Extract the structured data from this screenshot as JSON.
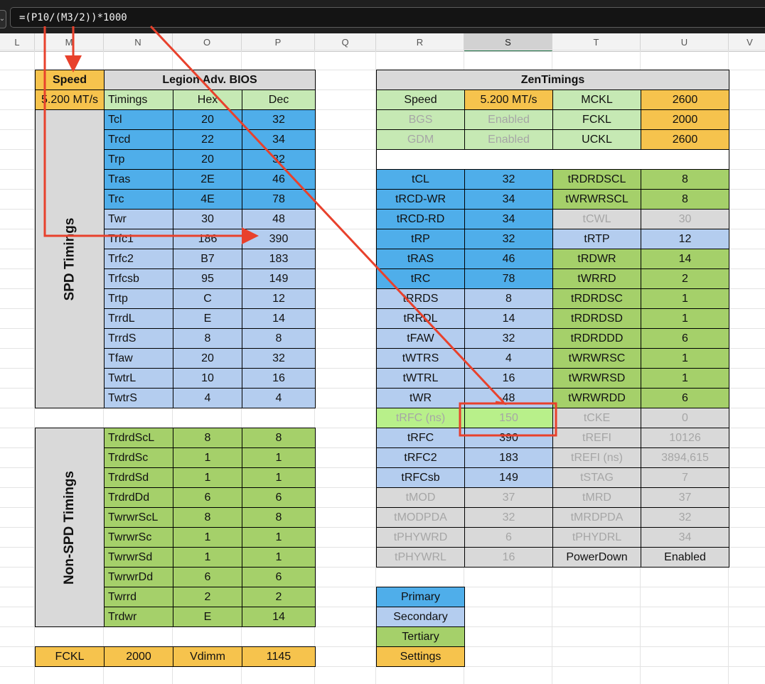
{
  "formula_bar": {
    "formula": "=(P10/(M3/2))*1000"
  },
  "column_headers": [
    "L",
    "M",
    "N",
    "O",
    "P",
    "Q",
    "R",
    "S",
    "T",
    "U",
    "V"
  ],
  "colors": {
    "primary": "#4faeea",
    "secondary": "#b4cdef",
    "tertiary": "#a5d06a",
    "settings": "#f6c34d",
    "header_green": "#c6e9b4",
    "arrow_red": "#e8412c"
  },
  "legion": {
    "speed_label": "Speed",
    "speed_value": "5.200 MT/s",
    "title": "Legion Adv. BIOS",
    "col_timings": "Timings",
    "col_hex": "Hex",
    "col_dec": "Dec",
    "spd_label": "SPD Timings",
    "nonspd_label": "Non-SPD Timings",
    "spd_rows": [
      {
        "name": "Tcl",
        "hex": "20",
        "dec": "32",
        "cat": "primary"
      },
      {
        "name": "Trcd",
        "hex": "22",
        "dec": "34",
        "cat": "primary"
      },
      {
        "name": "Trp",
        "hex": "20",
        "dec": "32",
        "cat": "primary"
      },
      {
        "name": "Tras",
        "hex": "2E",
        "dec": "46",
        "cat": "primary"
      },
      {
        "name": "Trc",
        "hex": "4E",
        "dec": "78",
        "cat": "primary"
      },
      {
        "name": "Twr",
        "hex": "30",
        "dec": "48",
        "cat": "secondary"
      },
      {
        "name": "Trfc1",
        "hex": "186",
        "dec": "390",
        "cat": "secondary"
      },
      {
        "name": "Trfc2",
        "hex": "B7",
        "dec": "183",
        "cat": "secondary"
      },
      {
        "name": "Trfcsb",
        "hex": "95",
        "dec": "149",
        "cat": "secondary"
      },
      {
        "name": "Trtp",
        "hex": "C",
        "dec": "12",
        "cat": "secondary"
      },
      {
        "name": "TrrdL",
        "hex": "E",
        "dec": "14",
        "cat": "secondary"
      },
      {
        "name": "TrrdS",
        "hex": "8",
        "dec": "8",
        "cat": "secondary"
      },
      {
        "name": "Tfaw",
        "hex": "20",
        "dec": "32",
        "cat": "secondary"
      },
      {
        "name": "TwtrL",
        "hex": "10",
        "dec": "16",
        "cat": "secondary"
      },
      {
        "name": "TwtrS",
        "hex": "4",
        "dec": "4",
        "cat": "secondary"
      }
    ],
    "nonspd_rows": [
      {
        "name": "TrdrdScL",
        "hex": "8",
        "dec": "8"
      },
      {
        "name": "TrdrdSc",
        "hex": "1",
        "dec": "1"
      },
      {
        "name": "TrdrdSd",
        "hex": "1",
        "dec": "1"
      },
      {
        "name": "TrdrdDd",
        "hex": "6",
        "dec": "6"
      },
      {
        "name": "TwrwrScL",
        "hex": "8",
        "dec": "8"
      },
      {
        "name": "TwrwrSc",
        "hex": "1",
        "dec": "1"
      },
      {
        "name": "TwrwrSd",
        "hex": "1",
        "dec": "1"
      },
      {
        "name": "TwrwrDd",
        "hex": "6",
        "dec": "6"
      },
      {
        "name": "Twrrd",
        "hex": "2",
        "dec": "2"
      },
      {
        "name": "Trdwr",
        "hex": "E",
        "dec": "14"
      }
    ],
    "bottom": {
      "fckl_label": "FCKL",
      "fckl_value": "2000",
      "vdimm_label": "Vdimm",
      "vdimm_value": "1145"
    }
  },
  "zen": {
    "title": "ZenTimings",
    "settings": [
      [
        {
          "t": "Speed",
          "s": "ltgreen"
        },
        {
          "t": "5.200 MT/s",
          "s": "orange"
        },
        {
          "t": "MCKL",
          "s": "ltgreen"
        },
        {
          "t": "2600",
          "s": "orange"
        }
      ],
      [
        {
          "t": "BGS",
          "s": "ltgreen faded"
        },
        {
          "t": "Enabled",
          "s": "ltgreen faded"
        },
        {
          "t": "FCKL",
          "s": "ltgreen"
        },
        {
          "t": "2000",
          "s": "orange"
        }
      ],
      [
        {
          "t": "GDM",
          "s": "ltgreen faded"
        },
        {
          "t": "Enabled",
          "s": "ltgreen faded"
        },
        {
          "t": "UCKL",
          "s": "ltgreen"
        },
        {
          "t": "2600",
          "s": "orange"
        }
      ]
    ],
    "rows": [
      [
        {
          "t": "tCL",
          "s": "blue"
        },
        {
          "t": "32",
          "s": "blue"
        },
        {
          "t": "tRDRDSCL",
          "s": "green"
        },
        {
          "t": "8",
          "s": "green"
        }
      ],
      [
        {
          "t": "tRCD-WR",
          "s": "blue"
        },
        {
          "t": "34",
          "s": "blue"
        },
        {
          "t": "tWRWRSCL",
          "s": "green"
        },
        {
          "t": "8",
          "s": "green"
        }
      ],
      [
        {
          "t": "tRCD-RD",
          "s": "blue"
        },
        {
          "t": "34",
          "s": "blue"
        },
        {
          "t": "tCWL",
          "s": "grey faded"
        },
        {
          "t": "30",
          "s": "grey faded"
        }
      ],
      [
        {
          "t": "tRP",
          "s": "blue"
        },
        {
          "t": "32",
          "s": "blue"
        },
        {
          "t": "tRTP",
          "s": "ltblue"
        },
        {
          "t": "12",
          "s": "ltblue"
        }
      ],
      [
        {
          "t": "tRAS",
          "s": "blue"
        },
        {
          "t": "46",
          "s": "blue"
        },
        {
          "t": "tRDWR",
          "s": "green"
        },
        {
          "t": "14",
          "s": "green"
        }
      ],
      [
        {
          "t": "tRC",
          "s": "blue"
        },
        {
          "t": "78",
          "s": "blue"
        },
        {
          "t": "tWRRD",
          "s": "green"
        },
        {
          "t": "2",
          "s": "green"
        }
      ],
      [
        {
          "t": "tRRDS",
          "s": "ltblue"
        },
        {
          "t": "8",
          "s": "ltblue"
        },
        {
          "t": "tRDRDSC",
          "s": "green"
        },
        {
          "t": "1",
          "s": "green"
        }
      ],
      [
        {
          "t": "tRRDL",
          "s": "ltblue"
        },
        {
          "t": "14",
          "s": "ltblue"
        },
        {
          "t": "tRDRDSD",
          "s": "green"
        },
        {
          "t": "1",
          "s": "green"
        }
      ],
      [
        {
          "t": "tFAW",
          "s": "ltblue"
        },
        {
          "t": "32",
          "s": "ltblue"
        },
        {
          "t": "tRDRDDD",
          "s": "green"
        },
        {
          "t": "6",
          "s": "green"
        }
      ],
      [
        {
          "t": "tWTRS",
          "s": "ltblue"
        },
        {
          "t": "4",
          "s": "ltblue"
        },
        {
          "t": "tWRWRSC",
          "s": "green"
        },
        {
          "t": "1",
          "s": "green"
        }
      ],
      [
        {
          "t": "tWTRL",
          "s": "ltblue"
        },
        {
          "t": "16",
          "s": "ltblue"
        },
        {
          "t": "tWRWRSD",
          "s": "green"
        },
        {
          "t": "1",
          "s": "green"
        }
      ],
      [
        {
          "t": "tWR",
          "s": "ltblue"
        },
        {
          "t": "48",
          "s": "ltblue"
        },
        {
          "t": "tWRWRDD",
          "s": "green"
        },
        {
          "t": "6",
          "s": "green"
        }
      ],
      [
        {
          "t": "tRFC (ns)",
          "s": "brightgreen faded"
        },
        {
          "t": "150",
          "s": "brightgreen faded"
        },
        {
          "t": "tCKE",
          "s": "grey faded"
        },
        {
          "t": "0",
          "s": "grey faded"
        }
      ],
      [
        {
          "t": "tRFC",
          "s": "ltblue"
        },
        {
          "t": "390",
          "s": "ltblue"
        },
        {
          "t": "tREFI",
          "s": "grey faded"
        },
        {
          "t": "10126",
          "s": "grey faded"
        }
      ],
      [
        {
          "t": "tRFC2",
          "s": "ltblue"
        },
        {
          "t": "183",
          "s": "ltblue"
        },
        {
          "t": "tREFI (ns)",
          "s": "grey faded"
        },
        {
          "t": "3894,615",
          "s": "grey faded"
        }
      ],
      [
        {
          "t": "tRFCsb",
          "s": "ltblue"
        },
        {
          "t": "149",
          "s": "ltblue"
        },
        {
          "t": "tSTAG",
          "s": "grey faded"
        },
        {
          "t": "7",
          "s": "grey faded"
        }
      ],
      [
        {
          "t": "tMOD",
          "s": "grey faded"
        },
        {
          "t": "37",
          "s": "grey faded"
        },
        {
          "t": "tMRD",
          "s": "grey faded"
        },
        {
          "t": "37",
          "s": "grey faded"
        }
      ],
      [
        {
          "t": "tMODPDA",
          "s": "grey faded"
        },
        {
          "t": "32",
          "s": "grey faded"
        },
        {
          "t": "tMRDPDA",
          "s": "grey faded"
        },
        {
          "t": "32",
          "s": "grey faded"
        }
      ],
      [
        {
          "t": "tPHYWRD",
          "s": "grey faded"
        },
        {
          "t": "6",
          "s": "grey faded"
        },
        {
          "t": "tPHYDRL",
          "s": "grey faded"
        },
        {
          "t": "34",
          "s": "grey faded"
        }
      ],
      [
        {
          "t": "tPHYWRL",
          "s": "grey faded"
        },
        {
          "t": "16",
          "s": "grey faded"
        },
        {
          "t": "PowerDown",
          "s": "grey"
        },
        {
          "t": "Enabled",
          "s": "grey"
        }
      ]
    ]
  },
  "legend": [
    {
      "label": "Primary",
      "s": "blue"
    },
    {
      "label": "Secondary",
      "s": "ltblue"
    },
    {
      "label": "Tertiary",
      "s": "green"
    },
    {
      "label": "Settings",
      "s": "orange"
    }
  ]
}
